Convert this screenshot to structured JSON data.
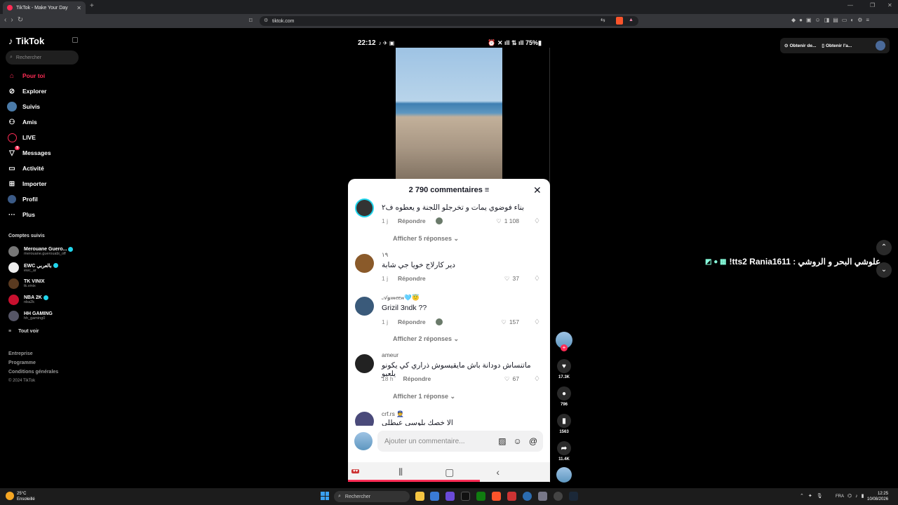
{
  "browser": {
    "tab_title": "TikTok - Make Your Day",
    "url": "tiktok.com"
  },
  "sidebar": {
    "logo": "TikTok",
    "search_placeholder": "Rechercher",
    "nav": [
      {
        "label": "Pour toi",
        "icon": "home-icon",
        "active": true
      },
      {
        "label": "Explorer",
        "icon": "compass-icon"
      },
      {
        "label": "Suivis",
        "icon": "following-avatar-icon"
      },
      {
        "label": "Amis",
        "icon": "friends-icon"
      },
      {
        "label": "LIVE",
        "icon": "live-icon"
      },
      {
        "label": "Messages",
        "icon": "message-icon",
        "badge": "9"
      },
      {
        "label": "Activité",
        "icon": "activity-icon"
      },
      {
        "label": "Importer",
        "icon": "upload-icon"
      },
      {
        "label": "Profil",
        "icon": "profile-icon"
      },
      {
        "label": "Plus",
        "icon": "more-icon"
      }
    ],
    "followed_title": "Comptes suivis",
    "followed": [
      {
        "name": "Merouane Guero...",
        "handle": "merouane.guerouabi_off",
        "verified": true
      },
      {
        "name": "EWC بالعربي",
        "handle": "ewc_ar",
        "verified": true
      },
      {
        "name": "TK VINIX",
        "handle": "tk.vinix",
        "verified": false
      },
      {
        "name": "NBA 2K",
        "handle": "nba2k",
        "verified": true
      },
      {
        "name": "HH GAMING",
        "handle": "hh_gaming0",
        "verified": false
      }
    ],
    "see_all": "Tout voir",
    "footer": [
      "Entreprise",
      "Programme",
      "Conditions générales"
    ],
    "copyright": "© 2024 TikTok"
  },
  "topright": {
    "btn1": "Obtenir de...",
    "btn2": "Obtenir l'a..."
  },
  "phone": {
    "time": "22:12",
    "battery": "75%"
  },
  "comments": {
    "title": "2 790 commentaires",
    "items": [
      {
        "user": "",
        "text": "بناء فوضوي يمات و تخرجلو اللجنة و يعطوه ف٢",
        "time": "1 j",
        "reply": "Répondre",
        "likes": "1 108",
        "creator_liked": true
      },
      {
        "more": "Afficher 5 réponses"
      },
      {
        "user": "١٩",
        "text": "دير كارلاج خويا جي شابة",
        "time": "1 j",
        "reply": "Répondre",
        "likes": "37"
      },
      {
        "user": "𝒜𝓎𝓂𝑒𝑒𝓃🩵😇",
        "text": "Grizil 3ndk ??",
        "time": "1 j",
        "reply": "Répondre",
        "likes": "157",
        "creator_liked": true
      },
      {
        "more": "Afficher 2 réponses"
      },
      {
        "user": "ameur",
        "text": "ماتنساش دودانة باش مايقيسوش ذراري كي يكونو يلعبو",
        "time": "18 h",
        "reply": "Répondre",
        "likes": "67"
      },
      {
        "more": "Afficher 1 réponse"
      },
      {
        "user": "crf.rs 👮",
        "text": "الا خصك بلوسي عيطلي",
        "time": "",
        "reply": "",
        "likes": ""
      }
    ],
    "compose_placeholder": "Ajouter un commentaire..."
  },
  "rail": {
    "likes": "17.3K",
    "comments": "796",
    "saves": "1563",
    "shares": "11.4K"
  },
  "banner": {
    "text": "!tts2 Rania1611 : علوشي البحر و الروشي"
  },
  "taskbar": {
    "temp": "25°C",
    "weather": "Ensoleillé",
    "search": "Rechercher",
    "lang": "FRA",
    "time": "12:25",
    "date": "10/08/2026"
  },
  "colors": {
    "accent": "#fe2c55",
    "verified": "#20d5ec",
    "background": "#000000"
  }
}
